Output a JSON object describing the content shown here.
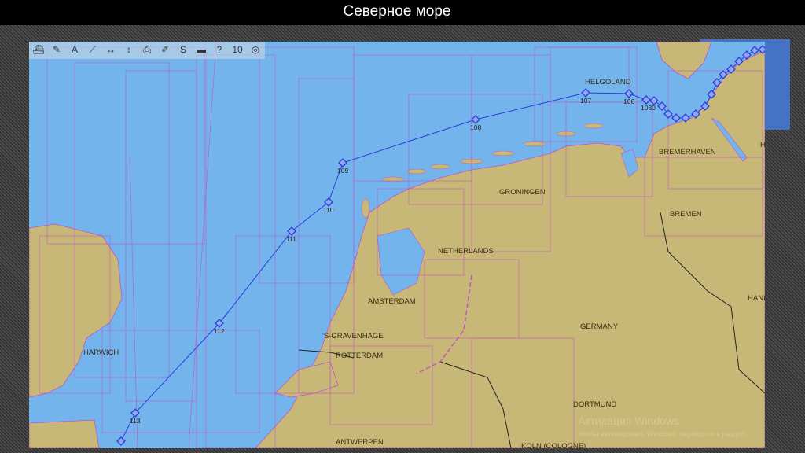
{
  "slide_title": "Северное море",
  "toolbar": [
    {
      "icon": "ship-icon",
      "glyph": "⛴"
    },
    {
      "icon": "pencil-icon",
      "glyph": "✎"
    },
    {
      "icon": "text-icon",
      "glyph": "A"
    },
    {
      "icon": "route-icon",
      "glyph": "⟋"
    },
    {
      "icon": "measure-horizontal-icon",
      "glyph": "↔"
    },
    {
      "icon": "measure-vertical-icon",
      "glyph": "↕"
    },
    {
      "icon": "print-icon",
      "glyph": "⎙"
    },
    {
      "icon": "edit-chart-icon",
      "glyph": "✐"
    },
    {
      "icon": "curve-icon",
      "glyph": "S"
    },
    {
      "icon": "layers-icon",
      "glyph": "▬"
    },
    {
      "icon": "help-icon",
      "glyph": "?"
    },
    {
      "icon": "zoom-level-icon",
      "glyph": "10"
    },
    {
      "icon": "lifebuoy-icon",
      "glyph": "◎"
    }
  ],
  "waypoints": [
    {
      "id": "107",
      "label": "107"
    },
    {
      "id": "106",
      "label": "106"
    },
    {
      "id": "1030",
      "label": "1030"
    },
    {
      "id": "108",
      "label": "108"
    },
    {
      "id": "109",
      "label": "109"
    },
    {
      "id": "110",
      "label": "110"
    },
    {
      "id": "111",
      "label": "111"
    },
    {
      "id": "112",
      "label": "112"
    },
    {
      "id": "113",
      "label": "113"
    }
  ],
  "places": {
    "helgoland": "HELGOLAND",
    "bremerhaven": "BREMERHAVEN",
    "bremen": "BREMEN",
    "groningen": "GRONINGEN",
    "netherlands": "NETHERLANDS",
    "amsterdam": "AMSTERDAM",
    "gravenhage": "'S-GRAVENHAGE",
    "rotterdam": "ROTTERDAM",
    "germany": "GERMANY",
    "dortmund": "DORTMUND",
    "koln": "KOLN (COLOGNE)",
    "antwerpen": "ANTWERPEN",
    "harwich": "HARWICH",
    "hannover": "HANI",
    "hamburg": "H"
  },
  "watermark": {
    "title": "Активация Windows",
    "subtitle": "Чтобы активировать Windows, перейдите в раздел"
  },
  "colors": {
    "sea": "#74b4ec",
    "land": "#c8b877",
    "grid": "#c050c8",
    "route": "#2a3cdc"
  }
}
